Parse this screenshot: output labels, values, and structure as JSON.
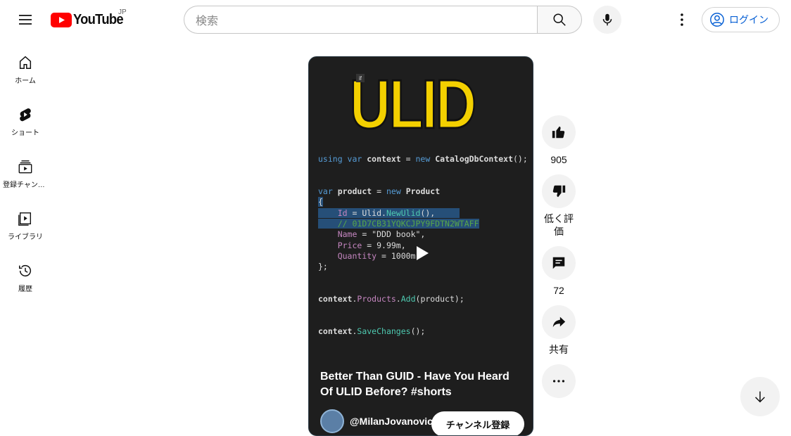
{
  "header": {
    "logo_text": "YouTube",
    "region": "JP",
    "search_placeholder": "検索",
    "login_label": "ログイン"
  },
  "sidebar": {
    "items": [
      {
        "label": "ホーム",
        "icon": "home-icon"
      },
      {
        "label": "ショート",
        "icon": "shorts-icon"
      },
      {
        "label": "登録チャンネル",
        "icon": "subscriptions-icon"
      },
      {
        "label": "ライブラリ",
        "icon": "library-icon"
      },
      {
        "label": "履歴",
        "icon": "history-icon"
      }
    ]
  },
  "video": {
    "thumbnail_heading": "ULID",
    "badge": "if",
    "code_lines": [
      "using var context = new CatalogDbContext();",
      "var product = new Product",
      "{",
      "    Id = Ulid.NewUlid(),",
      "    // 01D7CB31YQKCJPY9FDTN2WTAFF",
      "    Name = \"DDD book\",",
      "    Price = 9.99m,",
      "    Quantity = 1000m",
      "};",
      "context.Products.Add(product);",
      "context.SaveChanges();"
    ],
    "title": "Better Than GUID - Have You Heard Of ULID Before? #shorts",
    "channel": "@MilanJovanovic",
    "subscribe_label": "チャンネル登録"
  },
  "actions": {
    "likes": "905",
    "dislike_label": "低く評価",
    "comments": "72",
    "share_label": "共有"
  },
  "colors": {
    "brand_red": "#ff0000",
    "link_blue": "#065fd4",
    "ulid_yellow": "#f3d000"
  }
}
